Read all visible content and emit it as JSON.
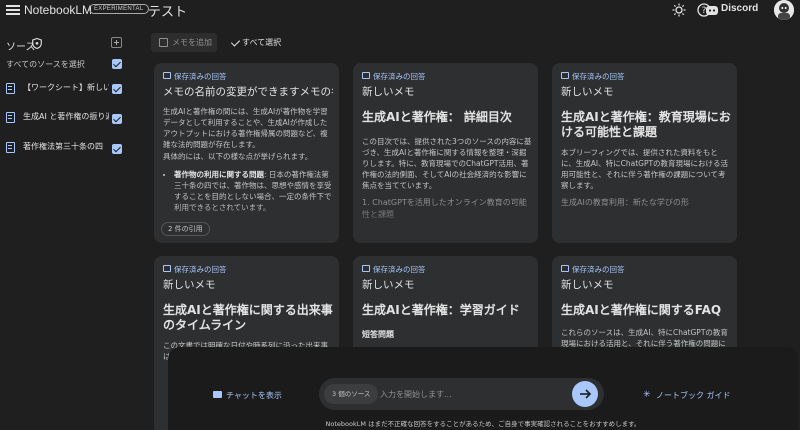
{
  "header": {
    "brand": "NotebookLM",
    "badge": "EXPERIMENTAL",
    "title": "テスト",
    "discord": "Discord"
  },
  "sidebar": {
    "heading": "ソース",
    "select_all": "すべてのソースを選択",
    "items": [
      {
        "label": "【ワークシート】新しい…"
      },
      {
        "label": "生成AI と著作権の振り返り"
      },
      {
        "label": "著作権法第三十条の四"
      }
    ]
  },
  "toolbar": {
    "add_memo": "メモを追加",
    "select_all": "すべて選択"
  },
  "cards": [
    {
      "tag": "保存済みの回答",
      "title": "メモの名前の変更ができますメモの名前",
      "body": "生成AIと著作権の間には、生成AIが著作物を学習データとして利用することや、生成AIが作成したアウトプットにおける著作権帰属の問題など、複雑な法的問題が存在します。",
      "body2": "具体的には、以下の様な点が挙げられます。",
      "bullet_bold": "著作物の利用に関する問題",
      "bullet_text": ": 日本の著作権法第三十条の四では、著作物は、思想や感情を享受することを目的としない場合、一定の条件下で利用できるとされています。",
      "citation": "2 件の引用"
    },
    {
      "tag": "保存済みの回答",
      "title": "新しいメモ",
      "heading": "生成AIと著作権： 詳細目次",
      "body": "この目次では、提供された3つのソースの内容に基づき、生成AIと著作権に関する情報を整理・深掘りします。特に、教育現場でのChatGPT活用、著作権の法的側面、そしてAIの社会経済的な影響に焦点を当てています。",
      "sub": "1. ChatGPTを活用したオンライン教育の可能性と課題"
    },
    {
      "tag": "保存済みの回答",
      "title": "新しいメモ",
      "heading": "生成AIと著作権：教育現場における可能性と課題",
      "body": "本ブリーフィングでは、提供された資料をもとに、生成AI、特にChatGPTの教育現場における活用可能性と、それに伴う著作権の課題について考察します。",
      "sub": "生成AIの教育利用：新たな学びの形"
    },
    {
      "tag": "保存済みの回答",
      "title": "新しいメモ",
      "heading": "生成AIと著作権に関する出来事のタイムライン",
      "body": "この文書では明確な日付や時系列に沿った出来事は記載されていません。"
    },
    {
      "tag": "保存済みの回答",
      "title": "新しいメモ",
      "heading": "生成AIと著作権：学習ガイド",
      "sub": "短答問題"
    },
    {
      "tag": "保存済みの回答",
      "title": "新しいメモ",
      "heading": "生成AIと著作権に関するFAQ",
      "body": "これらのソースは、生成AI、特にChatGPTの教育現場における活用と、それに伴う著作権の問題について論じています。"
    }
  ],
  "chat": {
    "show_chat": "チャットを表示",
    "source_count": "3 個のソース",
    "placeholder": "入力を開始します...",
    "notebook_guide": "ノートブック ガイド",
    "disclaimer": "NotebookLM はまだ不正確な回答をすることがあるため、ご自身で事実確認されることをおすすめします。"
  },
  "colors": {
    "accent": "#a8c7fa",
    "background": "#1f1f1f",
    "card": "#2e2f31"
  }
}
